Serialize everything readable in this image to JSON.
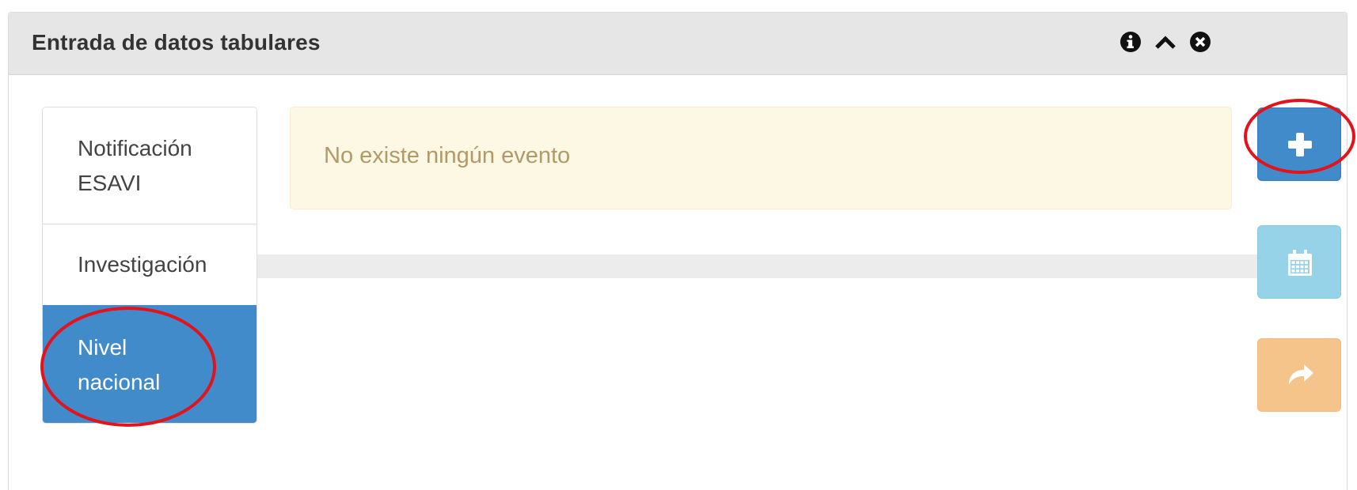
{
  "panel": {
    "title": "Entrada de datos tabulares",
    "header_icons": [
      "info-circle-icon",
      "chevron-up-icon",
      "close-circle-icon"
    ]
  },
  "tabs": [
    {
      "line1": "Notificación",
      "line2": "ESAVI",
      "active": false
    },
    {
      "line1": "Investigación",
      "line2": "",
      "active": false
    },
    {
      "line1": "Nivel",
      "line2": "nacional",
      "active": true
    }
  ],
  "alert": {
    "message": "No existe ningún evento"
  },
  "progress": {
    "value_percent": 0
  },
  "side_buttons": [
    {
      "icon": "plus-icon",
      "color": "#428bca"
    },
    {
      "icon": "calendar-icon",
      "color": "#96d3e9"
    },
    {
      "icon": "share-arrow-icon",
      "color": "#f5c48b"
    }
  ],
  "annotations": {
    "color": "#e3121b",
    "targets": [
      "add-button",
      "tab-nivel-nacional"
    ]
  },
  "colors": {
    "header_bg": "#e6e6e6",
    "active_tab": "#428bca",
    "alert_bg": "#fcf8e3",
    "alert_text": "#b3996a"
  }
}
